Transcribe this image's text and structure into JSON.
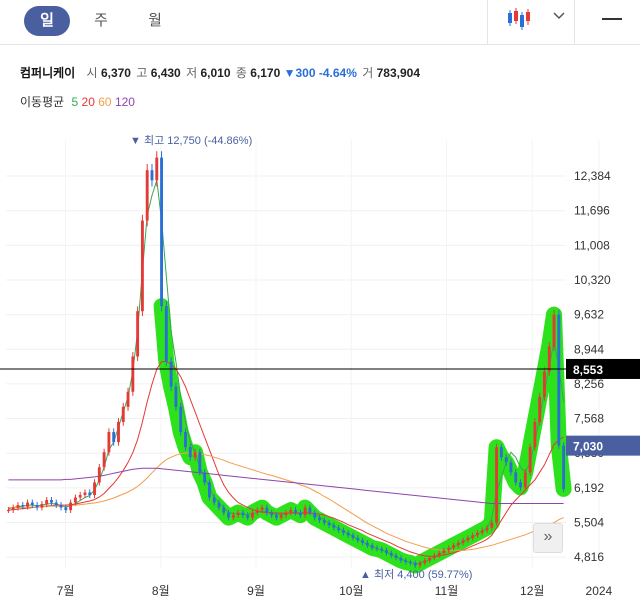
{
  "period_tabs": [
    {
      "label": "일",
      "active": true
    },
    {
      "label": "주",
      "active": false
    },
    {
      "label": "월",
      "active": false
    }
  ],
  "quote": {
    "name": "컴퍼니케이",
    "open_label": "시",
    "open": "6,370",
    "high_label": "고",
    "high": "6,430",
    "low_label": "저",
    "low": "6,010",
    "close_label": "종",
    "close": "6,170",
    "change": "▼300 -4.64%",
    "volume_label": "거",
    "volume": "783,904"
  },
  "ma_legend": {
    "title": "이동평균",
    "items": [
      {
        "label": "5",
        "color": "#34a853"
      },
      {
        "label": "20",
        "color": "#e53935"
      },
      {
        "label": "60",
        "color": "#f39c4a"
      },
      {
        "label": "120",
        "color": "#8e44ad"
      }
    ]
  },
  "colors": {
    "up": "#e53935",
    "down": "#2a6fd6",
    "highlight": "#22e010",
    "crosshair": "#000000",
    "current_badge": "#4a5fa0"
  },
  "icons": [
    "candlestick-chart-icon",
    "chevron-down-icon",
    "menu-icon",
    "double-chevron-right-icon"
  ],
  "chart_data": {
    "type": "candlestick",
    "x_tick_labels": [
      "7월",
      "8월",
      "9월",
      "10월",
      "11월",
      "12월",
      "2024"
    ],
    "y_tick_labels": [
      "12,384",
      "11,696",
      "11,008",
      "10,320",
      "9,632",
      "8,944",
      "8,256",
      "7,568",
      "6,880",
      "6,192",
      "5,504",
      "4,816"
    ],
    "ylim": [
      4600,
      13100
    ],
    "crosshair_value": "8,553",
    "current_price_value": "7,030",
    "high_annotation": "최고 12,750 (-44.86%)",
    "low_annotation": "최저 4,400 (59.77%)",
    "closes": [
      5750,
      5800,
      5850,
      5820,
      5900,
      5850,
      5800,
      5870,
      5950,
      5900,
      5850,
      5800,
      5750,
      5900,
      6000,
      6050,
      6100,
      6050,
      6300,
      6600,
      6900,
      7300,
      7100,
      7500,
      7800,
      8100,
      8800,
      9700,
      11500,
      12500,
      12300,
      12750,
      9800,
      8700,
      8200,
      7800,
      7300,
      7000,
      6800,
      6900,
      6500,
      6300,
      6000,
      5900,
      5800,
      5700,
      5600,
      5650,
      5700,
      5650,
      5600,
      5700,
      5750,
      5800,
      5700,
      5650,
      5600,
      5650,
      5700,
      5750,
      5700,
      5650,
      5800,
      5700,
      5600,
      5550,
      5500,
      5450,
      5400,
      5350,
      5300,
      5250,
      5200,
      5150,
      5100,
      5050,
      5000,
      4980,
      4950,
      4900,
      4850,
      4800,
      4750,
      4720,
      4700,
      4650,
      4700,
      4750,
      4800,
      4850,
      4900,
      4950,
      5000,
      5050,
      5100,
      5150,
      5200,
      5250,
      5300,
      5350,
      5400,
      5500,
      7000,
      6800,
      6700,
      6500,
      6300,
      6200,
      6500,
      7000,
      7500,
      8000,
      8500,
      9000,
      9632,
      7030,
      6170
    ],
    "series": [
      {
        "name": "5",
        "values": [
          5780,
          5800,
          5820,
          5830,
          5850,
          5850,
          5840,
          5850,
          5870,
          5880,
          5870,
          5840,
          5810,
          5840,
          5880,
          5940,
          6000,
          6040,
          6150,
          6350,
          6600,
          6950,
          7100,
          7400,
          7700,
          8000,
          8500,
          9300,
          10500,
          11600,
          12000,
          12300,
          11500,
          10400,
          9300,
          8700,
          8000,
          7500,
          7100,
          6900,
          6600,
          6400,
          6200,
          6000,
          5900,
          5800,
          5700,
          5680,
          5680,
          5670,
          5660,
          5680,
          5700,
          5730,
          5720,
          5690,
          5670,
          5660,
          5680,
          5700,
          5700,
          5690,
          5720,
          5700,
          5660,
          5610,
          5550,
          5490,
          5440,
          5390,
          5330,
          5280,
          5230,
          5170,
          5120,
          5070,
          5020,
          4990,
          4960,
          4920,
          4870,
          4820,
          4780,
          4740,
          4710,
          4690,
          4700,
          4730,
          4770,
          4820,
          4870,
          4920,
          4970,
          5020,
          5070,
          5120,
          5170,
          5220,
          5270,
          5320,
          5380,
          5600,
          6100,
          6400,
          6700,
          6900,
          6800,
          6600,
          6500,
          6700,
          7100,
          7600,
          8100,
          8600,
          9100,
          8600,
          7900
        ]
      },
      {
        "name": "20",
        "values": [
          5750,
          5760,
          5770,
          5780,
          5790,
          5800,
          5810,
          5820,
          5830,
          5840,
          5850,
          5850,
          5850,
          5860,
          5870,
          5890,
          5910,
          5930,
          5960,
          6010,
          6080,
          6180,
          6280,
          6400,
          6540,
          6700,
          6890,
          7150,
          7500,
          7900,
          8250,
          8550,
          8700,
          8700,
          8650,
          8550,
          8400,
          8200,
          7950,
          7700,
          7450,
          7200,
          6950,
          6700,
          6450,
          6250,
          6100,
          5990,
          5900,
          5850,
          5800,
          5760,
          5730,
          5710,
          5700,
          5700,
          5690,
          5690,
          5690,
          5690,
          5690,
          5690,
          5690,
          5690,
          5680,
          5670,
          5650,
          5620,
          5590,
          5550,
          5510,
          5460,
          5420,
          5380,
          5340,
          5290,
          5250,
          5210,
          5170,
          5130,
          5090,
          5040,
          5000,
          4960,
          4920,
          4890,
          4860,
          4840,
          4830,
          4830,
          4840,
          4860,
          4880,
          4900,
          4930,
          4960,
          5000,
          5040,
          5080,
          5120,
          5170,
          5250,
          5400,
          5550,
          5700,
          5850,
          5950,
          6050,
          6150,
          6250,
          6350,
          6500,
          6650,
          6850,
          7050,
          7150,
          7200
        ]
      },
      {
        "name": "60",
        "values": [
          5800,
          5800,
          5800,
          5800,
          5810,
          5810,
          5810,
          5820,
          5820,
          5830,
          5830,
          5830,
          5840,
          5840,
          5850,
          5860,
          5870,
          5880,
          5890,
          5910,
          5930,
          5960,
          5990,
          6030,
          6070,
          6110,
          6160,
          6220,
          6300,
          6390,
          6490,
          6590,
          6680,
          6750,
          6800,
          6840,
          6870,
          6880,
          6890,
          6880,
          6870,
          6850,
          6830,
          6800,
          6770,
          6740,
          6700,
          6670,
          6640,
          6610,
          6580,
          6550,
          6520,
          6490,
          6460,
          6440,
          6410,
          6380,
          6350,
          6320,
          6290,
          6250,
          6220,
          6180,
          6130,
          6080,
          6020,
          5970,
          5910,
          5850,
          5790,
          5730,
          5670,
          5610,
          5550,
          5490,
          5440,
          5390,
          5340,
          5290,
          5250,
          5210,
          5170,
          5130,
          5100,
          5070,
          5040,
          5010,
          4990,
          4970,
          4960,
          4950,
          4950,
          4950,
          4950,
          4950,
          4960,
          4970,
          4990,
          5010,
          5030,
          5050,
          5080,
          5110,
          5140,
          5170,
          5200,
          5230,
          5260,
          5300,
          5340,
          5380,
          5420,
          5460,
          5500,
          5560,
          5600
        ]
      },
      {
        "name": "120",
        "values": [
          6350,
          6350,
          6350,
          6350,
          6350,
          6350,
          6350,
          6350,
          6350,
          6350,
          6350,
          6350,
          6360,
          6360,
          6370,
          6380,
          6390,
          6400,
          6410,
          6420,
          6440,
          6460,
          6480,
          6500,
          6520,
          6540,
          6560,
          6570,
          6580,
          6580,
          6580,
          6580,
          6570,
          6560,
          6550,
          6540,
          6530,
          6520,
          6510,
          6500,
          6490,
          6480,
          6470,
          6460,
          6450,
          6440,
          6430,
          6420,
          6410,
          6400,
          6390,
          6380,
          6370,
          6360,
          6350,
          6340,
          6330,
          6320,
          6310,
          6300,
          6290,
          6280,
          6270,
          6260,
          6250,
          6240,
          6230,
          6220,
          6210,
          6200,
          6190,
          6180,
          6170,
          6160,
          6150,
          6140,
          6130,
          6120,
          6110,
          6100,
          6090,
          6080,
          6070,
          6060,
          6050,
          6040,
          6030,
          6020,
          6010,
          6000,
          5990,
          5980,
          5970,
          5960,
          5950,
          5940,
          5930,
          5920,
          5910,
          5900,
          5890,
          5880,
          5880,
          5880,
          5880,
          5880,
          5880,
          5880,
          5880,
          5880,
          5880,
          5880,
          5880,
          5880,
          5880,
          5880,
          5880
        ]
      }
    ]
  }
}
